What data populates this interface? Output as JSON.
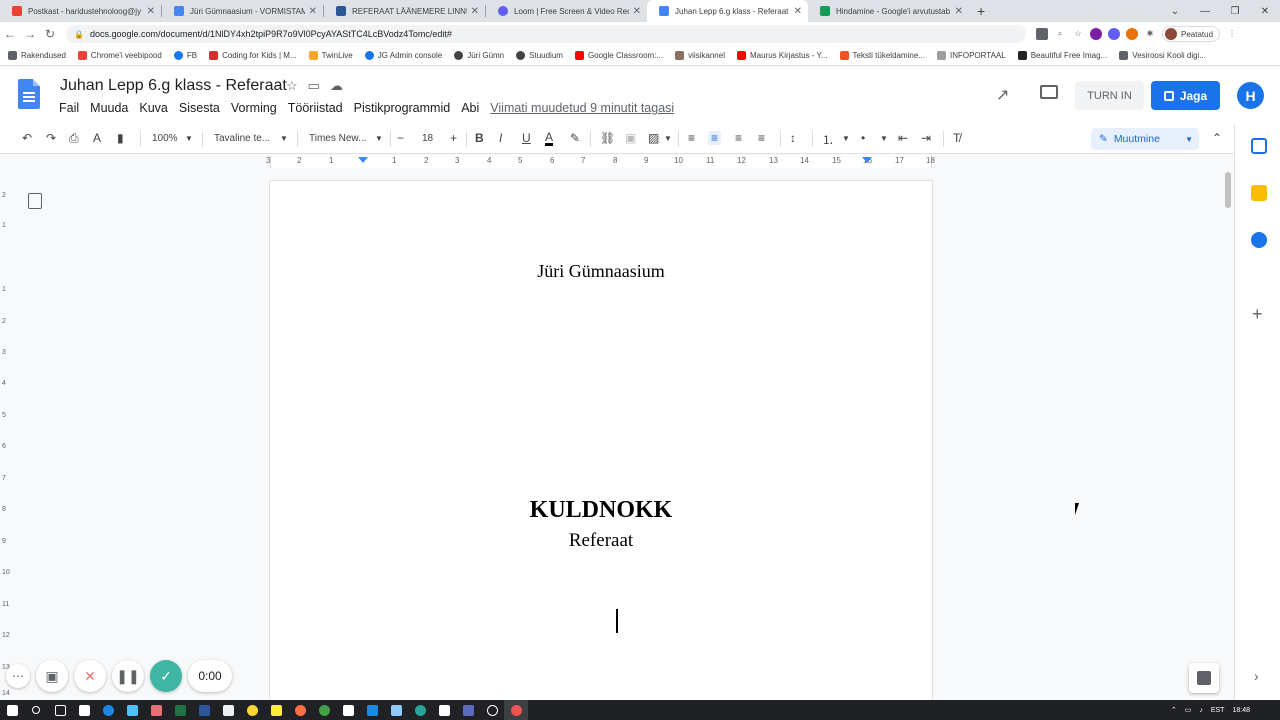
{
  "browser": {
    "tabs": [
      {
        "title": "Postkast - haridustehnoloog@jy",
        "favicon_color": "#ea4335"
      },
      {
        "title": "Jüri Gümnaasium - VORMISTAMI",
        "favicon_color": "#4285f4"
      },
      {
        "title": "REFERAAT LÄÄNEMERE LINNUD",
        "favicon_color": "#2b579a"
      },
      {
        "title": "Loom | Free Screen & Video Rec",
        "favicon_color": "#625df5"
      },
      {
        "title": "Juhan Lepp 6.g klass - Referaat -",
        "favicon_color": "#4285f4",
        "active": true
      },
      {
        "title": "Hindamine - Google'i arvutustab",
        "favicon_color": "#0f9d58"
      }
    ],
    "url": "docs.google.com/document/d/1NlDY4xh2tpiP9R7o9Vl0PcyAYAStTC4LcBVodz4Tomc/edit#",
    "profile_status": "Peatatud",
    "bookmarks": [
      "Rakendused",
      "Chrome'i veebipood",
      "FB",
      "Coding for Kids | M...",
      "TwinLive",
      "JG Admin console",
      "Jüri Gümn",
      "Stuudium",
      "Google Classroom:...",
      "viisikannel",
      "Maurus Kirjastus - Y...",
      "Teksti tükeldamine...",
      "INFOPORTAAL",
      "Beautiful Free Imag...",
      "Vesiroosi Kooli digi..."
    ]
  },
  "docs": {
    "title": "Juhan Lepp 6.g klass - Referaat",
    "menu": [
      "Fail",
      "Muuda",
      "Kuva",
      "Sisesta",
      "Vorming",
      "Tööriistad",
      "Pistikprogrammid",
      "Abi"
    ],
    "last_edit": "Viimati muudetud 9 minutit tagasi",
    "turn_in": "TURN IN",
    "share": "Jaga",
    "user_initial": "H"
  },
  "toolbar": {
    "zoom": "100%",
    "style": "Tavaline te...",
    "font": "Times New...",
    "font_size": "18",
    "mode": "Muutmine"
  },
  "ruler": {
    "ticks": [
      "3",
      "2",
      "1",
      "1",
      "2",
      "3",
      "4",
      "5",
      "6",
      "7",
      "8",
      "9",
      "10",
      "11",
      "12",
      "13",
      "14",
      "15",
      "16",
      "17",
      "18"
    ],
    "vticks": [
      "2",
      "1",
      "1",
      "2",
      "3",
      "4",
      "5",
      "6",
      "7",
      "8",
      "9",
      "10",
      "11",
      "12",
      "13",
      "14"
    ]
  },
  "document": {
    "school": "Jüri Gümnaasium",
    "title": "KULDNOKK",
    "subtitle": "Referaat"
  },
  "loom": {
    "timer": "0:00"
  },
  "taskbar": {
    "lang": "EST",
    "time": "18:48"
  }
}
